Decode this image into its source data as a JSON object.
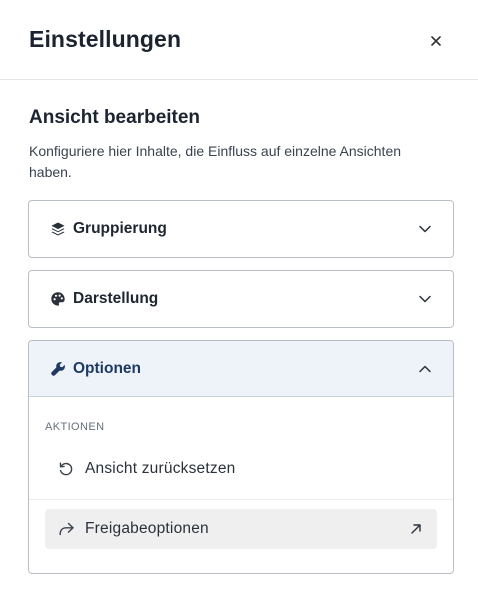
{
  "header": {
    "title": "Einstellungen",
    "close_icon": "close-icon"
  },
  "section": {
    "title": "Ansicht bearbeiten",
    "description": "Konfiguriere hier Inhalte, die Einfluss auf einzelne Ansichten haben."
  },
  "accordions": [
    {
      "label": "Gruppierung",
      "icon": "layers-icon",
      "expanded": false
    },
    {
      "label": "Darstellung",
      "icon": "palette-icon",
      "expanded": false
    },
    {
      "label": "Optionen",
      "icon": "wrench-icon",
      "expanded": true
    }
  ],
  "options": {
    "group_label": "AKTIONEN",
    "actions": [
      {
        "label": "Ansicht zurücksetzen",
        "icon": "reset-icon"
      },
      {
        "label": "Freigabeoptionen",
        "icon": "share-icon",
        "trailing_icon": "external-arrow-icon"
      }
    ]
  },
  "colors": {
    "accent_text": "#1e3a63",
    "open_header_bg": "#eef3f9",
    "highlight_bg": "#efefef",
    "border": "#b9bec6"
  }
}
